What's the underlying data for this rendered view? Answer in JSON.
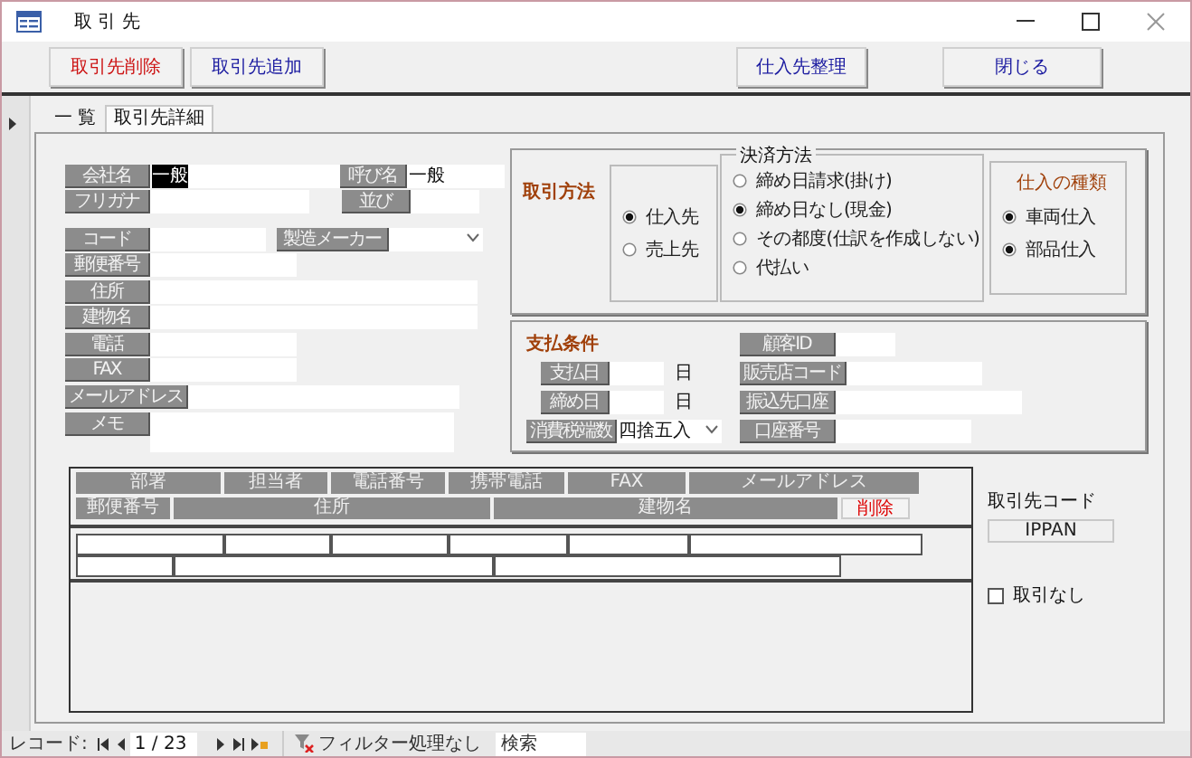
{
  "window": {
    "title": "取 引 先"
  },
  "toolbar": [
    {
      "label": "取引先削除",
      "kind": "danger"
    },
    {
      "label": "取引先追加",
      "kind": "normal"
    },
    {
      "label": "仕入先整理",
      "kind": "normal"
    },
    {
      "label": "閉じる",
      "kind": "normal"
    }
  ],
  "tabs": [
    {
      "label": "一 覧",
      "selected": false
    },
    {
      "label": "取引先詳細",
      "selected": true
    }
  ],
  "company": {
    "rows": [
      [
        {
          "label": "会社名",
          "value": "一般",
          "kind": "text",
          "highlighted": true
        },
        {
          "label": "呼び名",
          "value": "一般",
          "kind": "text",
          "highlighted": false
        }
      ],
      [
        {
          "label": "フリガナ",
          "kind": "text"
        },
        {
          "label": "並び",
          "kind": "text"
        }
      ],
      [
        {
          "label": "コード",
          "kind": "text"
        },
        {
          "label": "製造メーカー",
          "kind": "combo"
        }
      ],
      [
        {
          "label": "郵便番号",
          "kind": "text"
        }
      ],
      [
        {
          "label": "住所",
          "kind": "text"
        }
      ],
      [
        {
          "label": "建物名",
          "kind": "text"
        }
      ],
      [
        {
          "label": "電話",
          "kind": "text"
        }
      ],
      [
        {
          "label": "FAX",
          "kind": "text"
        }
      ],
      [
        {
          "label": "メールアドレス",
          "kind": "text"
        }
      ],
      [
        {
          "label": "メモ",
          "kind": "memo"
        }
      ]
    ]
  },
  "transaction": {
    "title": "取引方法",
    "options": [
      {
        "label": "仕入先",
        "selected": true
      },
      {
        "label": "売上先",
        "selected": false
      }
    ]
  },
  "settlement": {
    "title": "決済方法",
    "options": [
      {
        "label": "締め日請求(掛け)",
        "selected": false
      },
      {
        "label": "締め日なし(現金)",
        "selected": true
      },
      {
        "label": "その都度(仕訳を作成しない)",
        "selected": false
      },
      {
        "label": "代払い",
        "selected": false
      }
    ]
  },
  "purchase_type": {
    "title": "仕入の種類",
    "options": [
      {
        "label": "車両仕入",
        "checked": true
      },
      {
        "label": "部品仕入",
        "checked": true
      }
    ]
  },
  "payment_terms": {
    "title": "支払条件",
    "left": [
      {
        "label": "支払日",
        "unit": "日",
        "kind": "text"
      },
      {
        "label": "締め日",
        "unit": "日",
        "kind": "text"
      },
      {
        "label": "消費税端数",
        "value": "四捨五入",
        "kind": "combo"
      }
    ],
    "right": [
      {
        "label": "顧客ID"
      },
      {
        "label": "販売店コード"
      },
      {
        "label": "振込先口座"
      },
      {
        "label": "口座番号"
      }
    ]
  },
  "contacts": {
    "columns": [
      "部署",
      "担当者",
      "電話番号",
      "携帯電話",
      "FAX",
      "メールアドレス"
    ],
    "columns_2": [
      "郵便番号",
      "住所",
      "建物名"
    ],
    "delete_label": "削除"
  },
  "client_code": {
    "label": "取引先コード",
    "value": "IPPAN"
  },
  "inactive": {
    "label": "取引なし",
    "checked": false
  },
  "status_bar": {
    "record_label": "レコード:",
    "position": "1 / 23",
    "filter": "フィルター処理なし",
    "search_placeholder": "検索"
  }
}
